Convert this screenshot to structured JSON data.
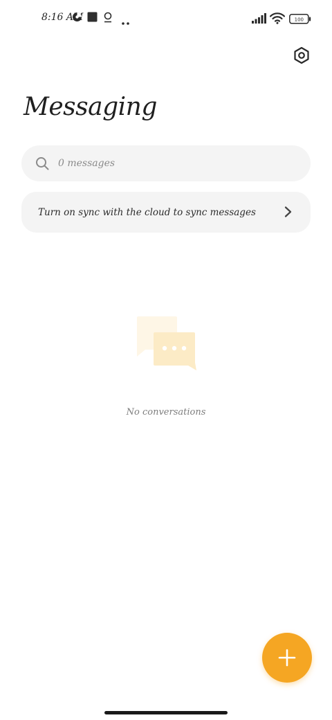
{
  "status_bar": {
    "time": "8:16 AM",
    "battery": "100",
    "icons": [
      "data-saver-icon",
      "square-notification-icon",
      "location-icon",
      "more-dots-icon",
      "signal-icon",
      "wifi-icon",
      "battery-icon"
    ]
  },
  "header": {
    "title": "Messaging",
    "settings_icon": "settings-hexagon-icon"
  },
  "search": {
    "placeholder": "0 messages",
    "value": ""
  },
  "sync_banner": {
    "text": "Turn on sync with the cloud to sync messages"
  },
  "empty_state": {
    "text": "No conversations"
  },
  "fab": {
    "icon": "plus-icon"
  },
  "colors": {
    "accent": "#f5a623",
    "surface": "#f4f4f4",
    "illustration_light": "#fdf3df",
    "illustration_dark": "#fbe7bd"
  }
}
